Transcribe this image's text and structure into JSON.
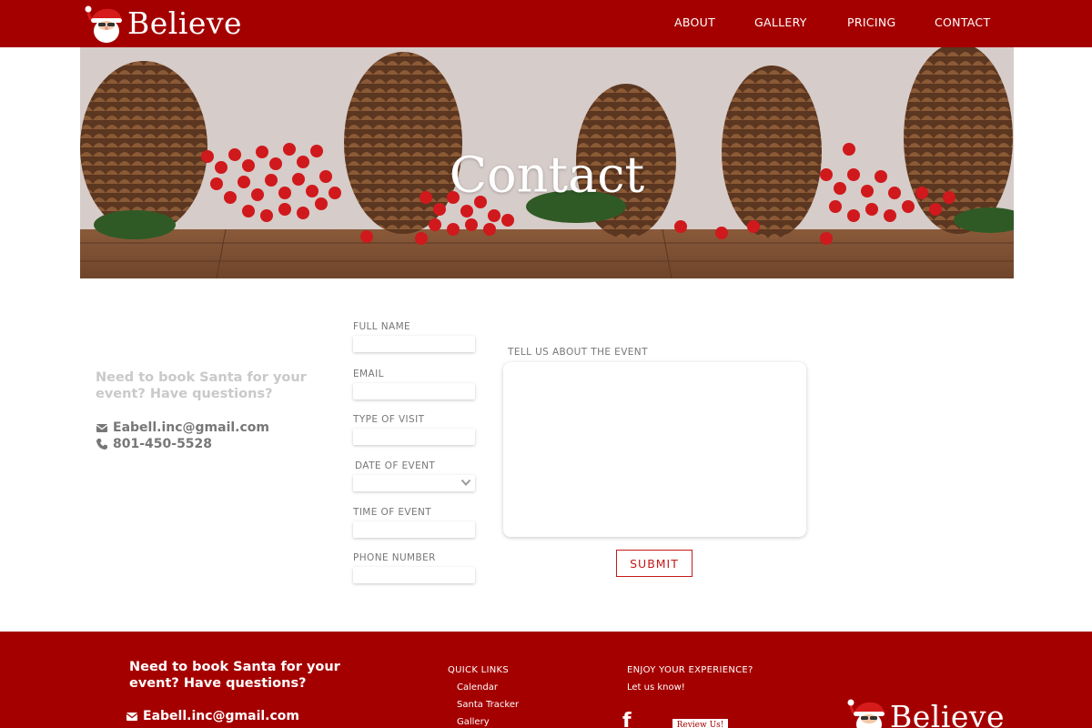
{
  "header": {
    "logo_text": "Believe",
    "nav": [
      "ABOUT",
      "GALLERY",
      "PRICING",
      "CONTACT"
    ]
  },
  "hero": {
    "title": "Contact"
  },
  "info": {
    "heading": "Need to book Santa for your event? Have questions?",
    "email": "Eabell.inc@gmail.com",
    "phone": "801-450-5528"
  },
  "form": {
    "full_name_label": "FULL NAME",
    "email_label": "EMAIL",
    "type_label": "TYPE OF VISIT",
    "date_label": "DATE OF EVENT",
    "time_label": "TIME OF EVENT",
    "phone_label": "PHONE NUMBER",
    "event_label": "TELL US ABOUT THE EVENT",
    "submit_label": "SUBMIT"
  },
  "footer": {
    "heading": "Need to book Santa for your event? Have questions?",
    "email": "Eabell.inc@gmail.com",
    "quick_links_title": "QUICK LINKS",
    "quick_links": [
      "Calendar",
      "Santa Tracker",
      "Gallery"
    ],
    "enjoy_title": "ENJOY YOUR EXPERIENCE?",
    "enjoy_sub": "Let us know!",
    "facebook": "f",
    "review_label": "Review Us!",
    "logo_text": "Believe"
  },
  "colors": {
    "brand_red": "#a50000",
    "accent_red": "#c41919"
  }
}
